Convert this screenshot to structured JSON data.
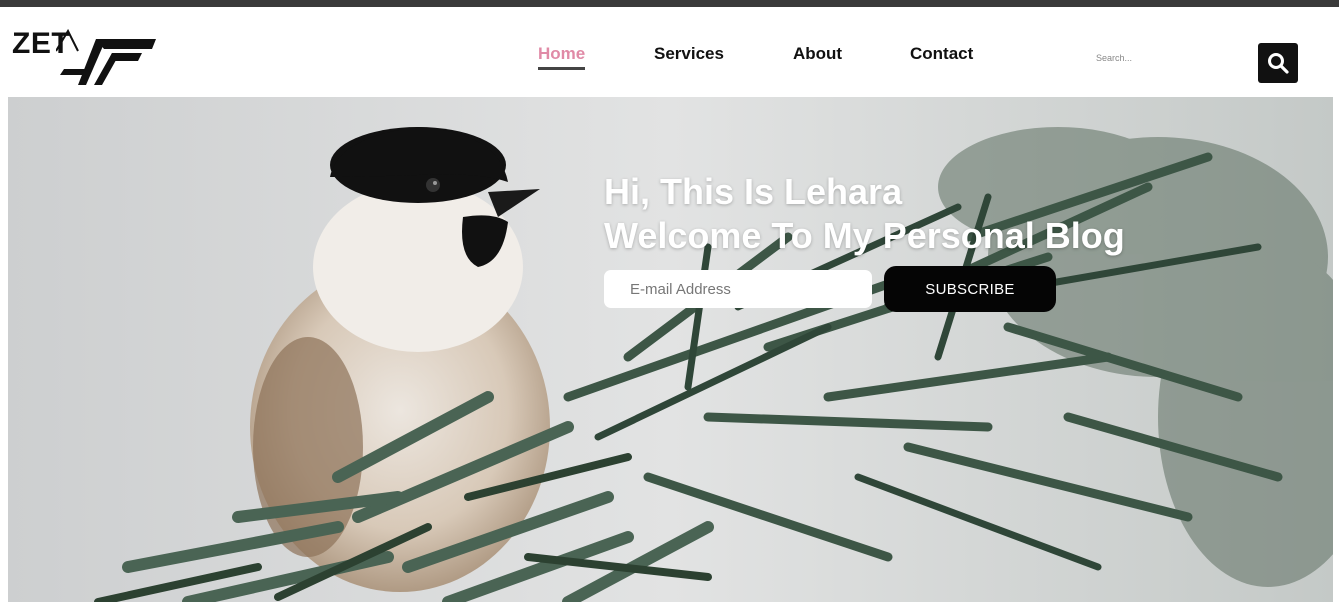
{
  "brand": {
    "logo_text": "ZET"
  },
  "nav": {
    "items": [
      {
        "label": "Home",
        "active": true
      },
      {
        "label": "Services",
        "active": false
      },
      {
        "label": "About",
        "active": false
      },
      {
        "label": "Contact",
        "active": false
      }
    ]
  },
  "search": {
    "placeholder": "Search...",
    "icon": "search-icon"
  },
  "hero": {
    "title_line1": "Hi, This Is Lehara",
    "title_line2": "Welcome To My Personal Blog",
    "email_placeholder": "E-mail Address",
    "subscribe_label": "SUBSCRIBE"
  },
  "colors": {
    "active_nav": "#e08aa6",
    "button": "#050505",
    "search_button": "#111111"
  }
}
